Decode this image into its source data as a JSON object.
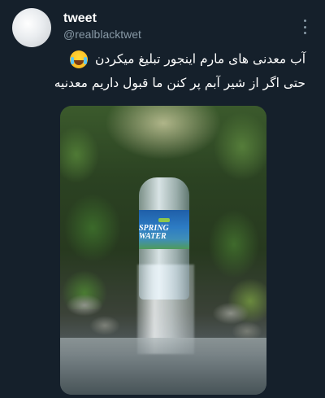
{
  "author": {
    "display_name": "tweet",
    "handle": "@realblacktwet"
  },
  "tweet": {
    "line1": "آب معدنی های مارم اینجور تبلیغ میکردن",
    "line2": "حتی اگر از شیر آبم پر کنن ما قبول داریم معدنیه"
  },
  "media": {
    "bottle_label": "SPRING WATER"
  },
  "icons": {
    "emoji": "face-with-tears-of-joy",
    "menu": "more-vertical-icon"
  },
  "colors": {
    "background": "#15202b",
    "secondary_text": "#8899a6"
  }
}
